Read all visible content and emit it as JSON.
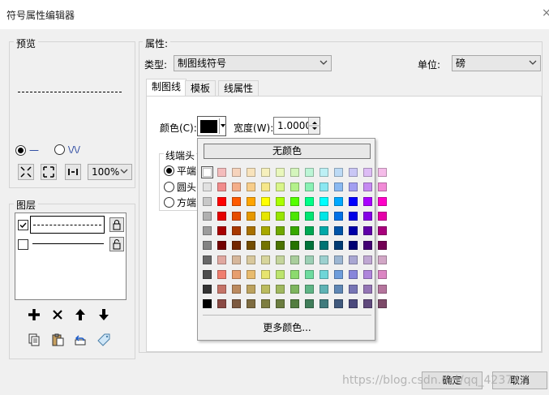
{
  "window": {
    "title": "符号属性编辑器",
    "close_glyph": "×"
  },
  "preview": {
    "label": "预览",
    "zoom": "100%",
    "radio_solid_glyph": "—",
    "radio_pattern_glyph": "\\/\\/"
  },
  "layers": {
    "label": "图层"
  },
  "properties": {
    "label": "属性:",
    "type_label": "类型:",
    "type_value": "制图线符号",
    "unit_label": "单位:",
    "unit_value": "磅"
  },
  "tabs": [
    {
      "label": "制图线"
    },
    {
      "label": "模板"
    },
    {
      "label": "线属性"
    }
  ],
  "cartographic": {
    "color_label": "颜色(C):",
    "width_label": "宽度(W):",
    "width_value": "1.0000",
    "cap_group_label": "线端头",
    "cap_options": [
      "平端:",
      "圆头:",
      "方端:"
    ],
    "selected_color": "#000000"
  },
  "color_popup": {
    "no_color_label": "无颜色",
    "more_colors_label": "更多颜色...",
    "palette": [
      [
        "#ffffff",
        "#f4bcbc",
        "#f6d3bc",
        "#f8e3bc",
        "#f6f0bc",
        "#e9f7bc",
        "#d4f5bc",
        "#bcf5d6",
        "#bcf0f5",
        "#bcdaf5",
        "#c9c6f5",
        "#ddbcf5",
        "#f5bce9"
      ],
      [
        "#e1e1e1",
        "#f18c8c",
        "#f4ae8a",
        "#f7cd8a",
        "#f6e78a",
        "#d9f58a",
        "#b3f18a",
        "#8af1b5",
        "#8ae7f1",
        "#8ab9f1",
        "#a29ef1",
        "#c58af1",
        "#f18ad6"
      ],
      [
        "#c8c8c8",
        "#ff0000",
        "#ff5a00",
        "#ffa500",
        "#ffff00",
        "#aaff00",
        "#55ff00",
        "#00ff88",
        "#00ffff",
        "#00a8ff",
        "#0000ff",
        "#a800ff",
        "#ff00c8"
      ],
      [
        "#b0b0b0",
        "#e60000",
        "#e64c00",
        "#e69800",
        "#e6e600",
        "#98e600",
        "#4ce600",
        "#00e673",
        "#00e6e6",
        "#0070e6",
        "#0000e6",
        "#8400e6",
        "#e600a9"
      ],
      [
        "#9c9c9c",
        "#a80000",
        "#a83800",
        "#a87000",
        "#a8a800",
        "#70a800",
        "#38a800",
        "#00a854",
        "#00a8a8",
        "#0054a8",
        "#0000a8",
        "#6000a8",
        "#a8007c"
      ],
      [
        "#828282",
        "#730000",
        "#732600",
        "#734c00",
        "#737300",
        "#4c7300",
        "#267300",
        "#00733a",
        "#007373",
        "#003a73",
        "#000073",
        "#420073",
        "#730055"
      ],
      [
        "#686868",
        "#e0a8a0",
        "#d6b79b",
        "#d8c89d",
        "#d7d59c",
        "#c4d49c",
        "#a9cd9c",
        "#9ccfb5",
        "#9cd0cf",
        "#9cb6d2",
        "#a9a7d2",
        "#bfa7d2",
        "#d2a7c6"
      ],
      [
        "#4e4e4e",
        "#f07e6e",
        "#e79e6e",
        "#e8bb6e",
        "#e7e46e",
        "#bce46e",
        "#8cda6e",
        "#6edb9f",
        "#6ed6d8",
        "#6e9ddb",
        "#8785db",
        "#ae85db",
        "#db85c3"
      ],
      [
        "#343434",
        "#c57468",
        "#bb8a5f",
        "#bca25f",
        "#bbbb5f",
        "#a0b85f",
        "#7eb55f",
        "#5fb586",
        "#5fb3b5",
        "#5f87b5",
        "#7775b5",
        "#9475b5",
        "#b5759d"
      ],
      [
        "#000000",
        "#8a4a44",
        "#7d5a40",
        "#7d6b40",
        "#7d7d40",
        "#6b7d40",
        "#537d40",
        "#407d5a",
        "#407b7d",
        "#40597d",
        "#4c4a7d",
        "#604a7d",
        "#7d4a69"
      ]
    ]
  },
  "footer": {
    "ok_label": "确定",
    "cancel_label": "取消",
    "watermark": "https://blog.csdn.net/qq_42374..."
  }
}
